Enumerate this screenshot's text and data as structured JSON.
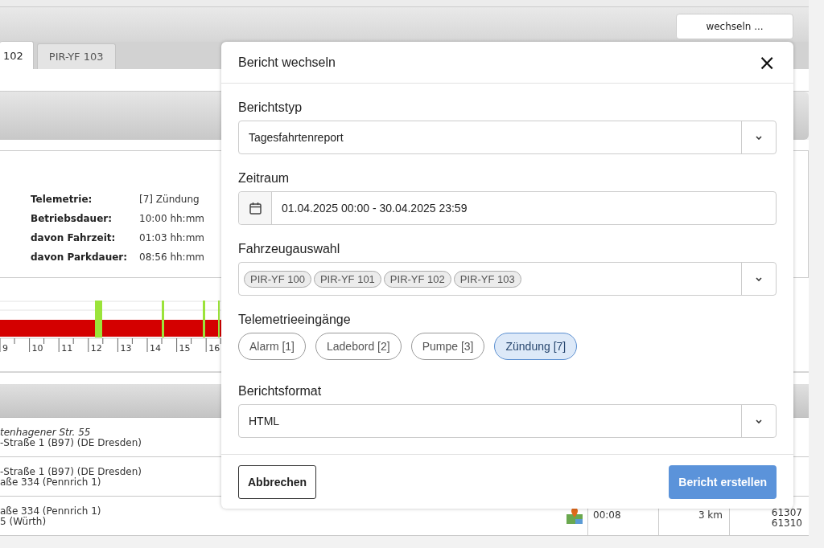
{
  "header": {
    "switch_button": "wechseln ..."
  },
  "tabs": [
    {
      "label": "102",
      "selected": true
    },
    {
      "label": "PIR-YF 103",
      "selected": false
    }
  ],
  "summary": [
    {
      "label": "Telemetrie:",
      "value": "[7] Zündung"
    },
    {
      "label": "Betriebsdauer:",
      "value": "10:00 hh:mm"
    },
    {
      "label": "davon Fahrzeit:",
      "value": "01:03 hh:mm"
    },
    {
      "label": "davon Parkdauer:",
      "value": "08:56 hh:mm"
    }
  ],
  "timeline": {
    "hour_labels": [
      "9",
      "10",
      "11",
      "12",
      "13",
      "14",
      "15",
      "16"
    ]
  },
  "trips": [
    {
      "address_lines": [
        {
          "text": "tenhagener Str. 55",
          "italic": true
        },
        {
          "text": "-Straße 1 (B97) (DE Dresden)",
          "italic": false
        }
      ]
    },
    {
      "address_lines": [
        {
          "text": "-Straße 1 (B97) (DE Dresden)",
          "italic": false
        },
        {
          "text": "aße 334 (Pennrich 1)",
          "italic": false
        }
      ]
    },
    {
      "address_lines": [
        {
          "text": "aße 334 (Pennrich 1)",
          "italic": false
        },
        {
          "text": "5 (Würth)",
          "italic": false
        }
      ],
      "duration": "00:08",
      "distance": "3 km",
      "ids": [
        "61307",
        "61310"
      ]
    }
  ],
  "dialog": {
    "title": "Bericht wechseln",
    "close": "×",
    "report_type": {
      "label": "Berichtstyp",
      "value": "Tagesfahrtenreport"
    },
    "period": {
      "label": "Zeitraum",
      "value": "01.04.2025 00:00 - 30.04.2025 23:59"
    },
    "vehicles": {
      "label": "Fahrzeugauswahl",
      "chips": [
        "PIR-YF 100",
        "PIR-YF 101",
        "PIR-YF 102",
        "PIR-YF 103"
      ]
    },
    "telemetry": {
      "label": "Telemetrieeingänge",
      "options": [
        {
          "label": "Alarm [1]",
          "selected": false
        },
        {
          "label": "Ladebord [2]",
          "selected": false
        },
        {
          "label": "Pumpe [3]",
          "selected": false
        },
        {
          "label": "Zündung [7]",
          "selected": true
        }
      ]
    },
    "format": {
      "label": "Berichtsformat",
      "value": "HTML"
    },
    "cancel": "Abbrechen",
    "submit": "Bericht erstellen"
  }
}
